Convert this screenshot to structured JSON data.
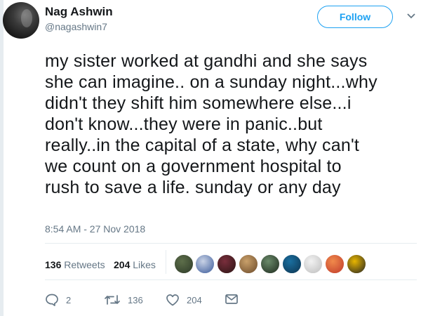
{
  "author": {
    "display_name": "Nag Ashwin",
    "handle": "@nagashwin7",
    "avatar_icon": "profile-photo"
  },
  "follow_label": "Follow",
  "tweet": {
    "text": "my sister worked at gandhi and she says\nshe can imagine.. on a sunday night...why\ndidn't they shift him somewhere else...i\ndon't know...they were in panic..but\nreally..in the capital of a state, why can't\nwe count on a government hospital to\nrush to save a life. sunday or any day",
    "timestamp": "8:54 AM - 27 Nov 2018"
  },
  "stats": {
    "retweets_count": "136",
    "retweets_label": "Retweets",
    "likes_count": "204",
    "likes_label": "Likes"
  },
  "liked_by": [
    {
      "name": "liker-avatar-1",
      "colors": [
        "#5d6e4a",
        "#2d3a28"
      ]
    },
    {
      "name": "liker-avatar-2",
      "colors": [
        "#c9d3e6",
        "#3a5a9a"
      ]
    },
    {
      "name": "liker-avatar-3",
      "colors": [
        "#7a2e3c",
        "#2a1414"
      ]
    },
    {
      "name": "liker-avatar-4",
      "colors": [
        "#c9a06a",
        "#6b4a2a"
      ]
    },
    {
      "name": "liker-avatar-5",
      "colors": [
        "#6a8a6a",
        "#1e2a1e"
      ]
    },
    {
      "name": "liker-avatar-6",
      "colors": [
        "#1a6fa0",
        "#0d3450"
      ]
    },
    {
      "name": "liker-avatar-7",
      "colors": [
        "#f2f2f2",
        "#bdbdbd"
      ]
    },
    {
      "name": "liker-avatar-8",
      "colors": [
        "#f08a4b",
        "#c0392b"
      ]
    },
    {
      "name": "liker-avatar-9",
      "colors": [
        "#e8b600",
        "#222222"
      ]
    }
  ],
  "actions": {
    "reply_count": "2",
    "retweet_count": "136",
    "like_count": "204"
  },
  "colors": {
    "accent": "#1da1f2",
    "secondary_text": "#657786",
    "primary_text": "#14171a",
    "divider": "#e6ecf0"
  }
}
